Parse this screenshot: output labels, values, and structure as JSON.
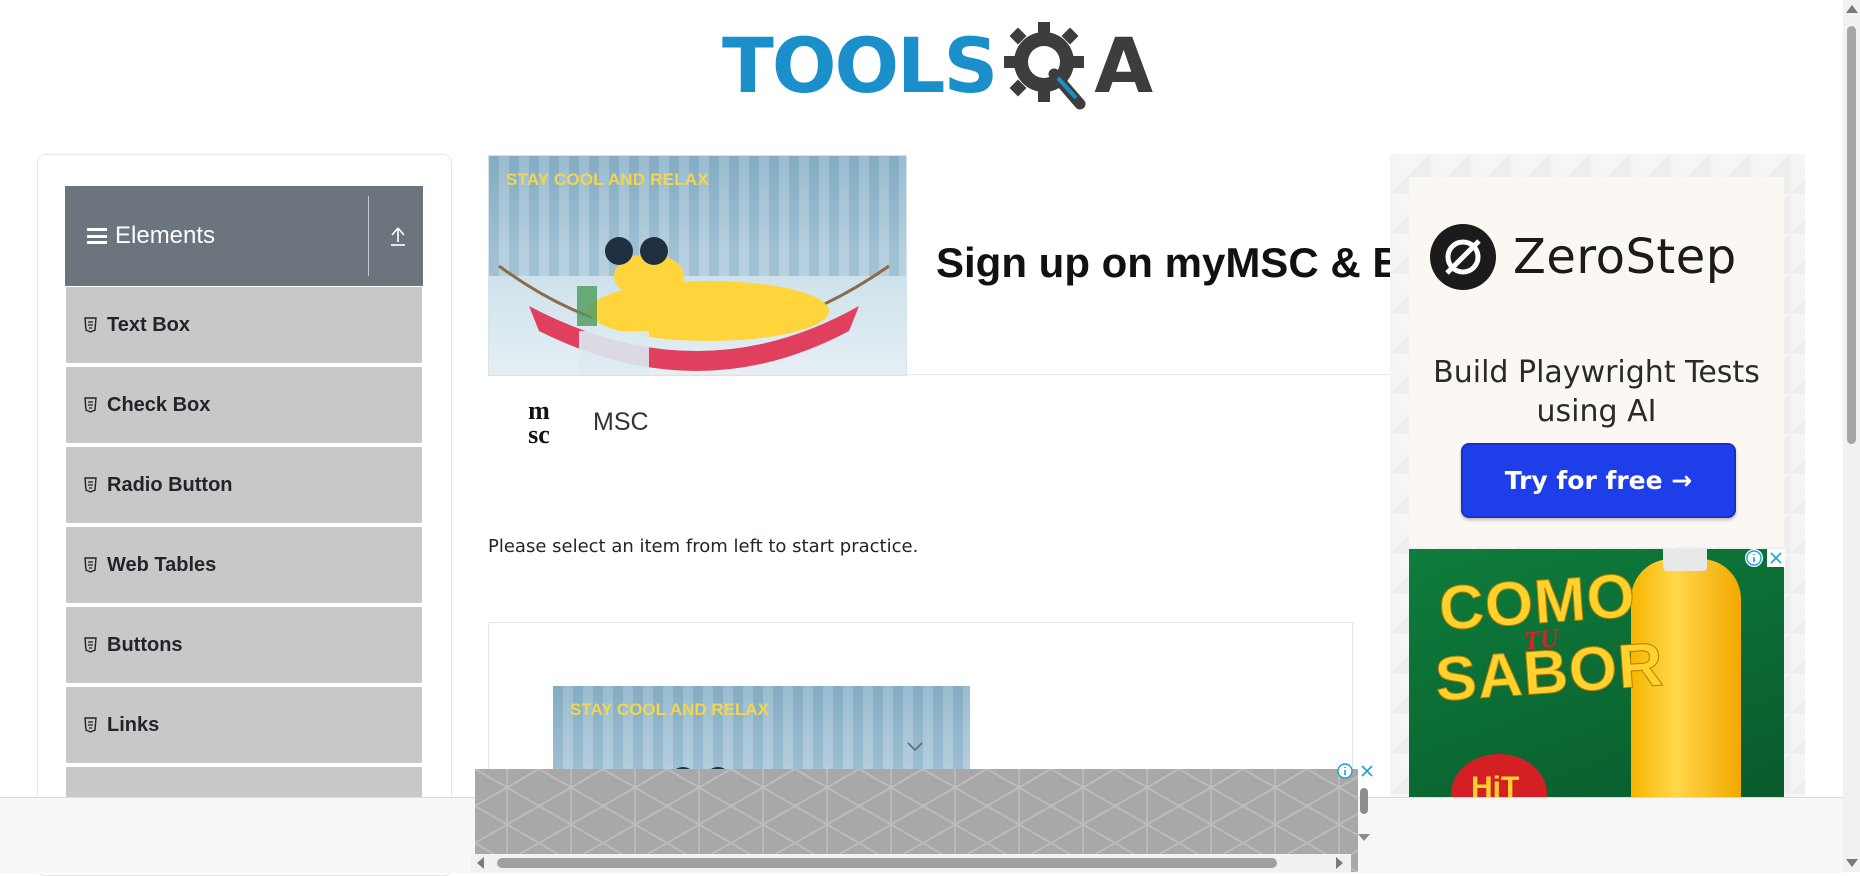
{
  "header": {
    "logo_text": "TOOLS",
    "logo_suffix": "A"
  },
  "sidebar": {
    "group_title": "Elements",
    "items": [
      {
        "label": "Text Box"
      },
      {
        "label": "Check Box"
      },
      {
        "label": "Radio Button"
      },
      {
        "label": "Web Tables"
      },
      {
        "label": "Buttons"
      },
      {
        "label": "Links"
      },
      {
        "label": ""
      }
    ]
  },
  "center_ad": {
    "banner_tag": "STAY COOL AND RELAX",
    "headline": "Sign up on myMSC & B",
    "brand_name": "MSC",
    "brand_logo_text": "msc"
  },
  "main": {
    "instruction": "Please select an item from left to start practice."
  },
  "lower_ad": {
    "banner_tag": "STAY COOL AND RELAX"
  },
  "right_ad": {
    "brand": "ZeroStep",
    "subtitle": "Build Playwright Tests using AI",
    "cta": "Try for free →",
    "soda_line1": "COMO",
    "soda_line2": "TU",
    "soda_line3": "SABOR",
    "soda_brand": "HiT"
  },
  "colors": {
    "brand_blue": "#1a8fc9",
    "group_header": "#6c757d",
    "menu_item_bg": "#c8c8c8",
    "cta_blue": "#1d3ee8"
  }
}
